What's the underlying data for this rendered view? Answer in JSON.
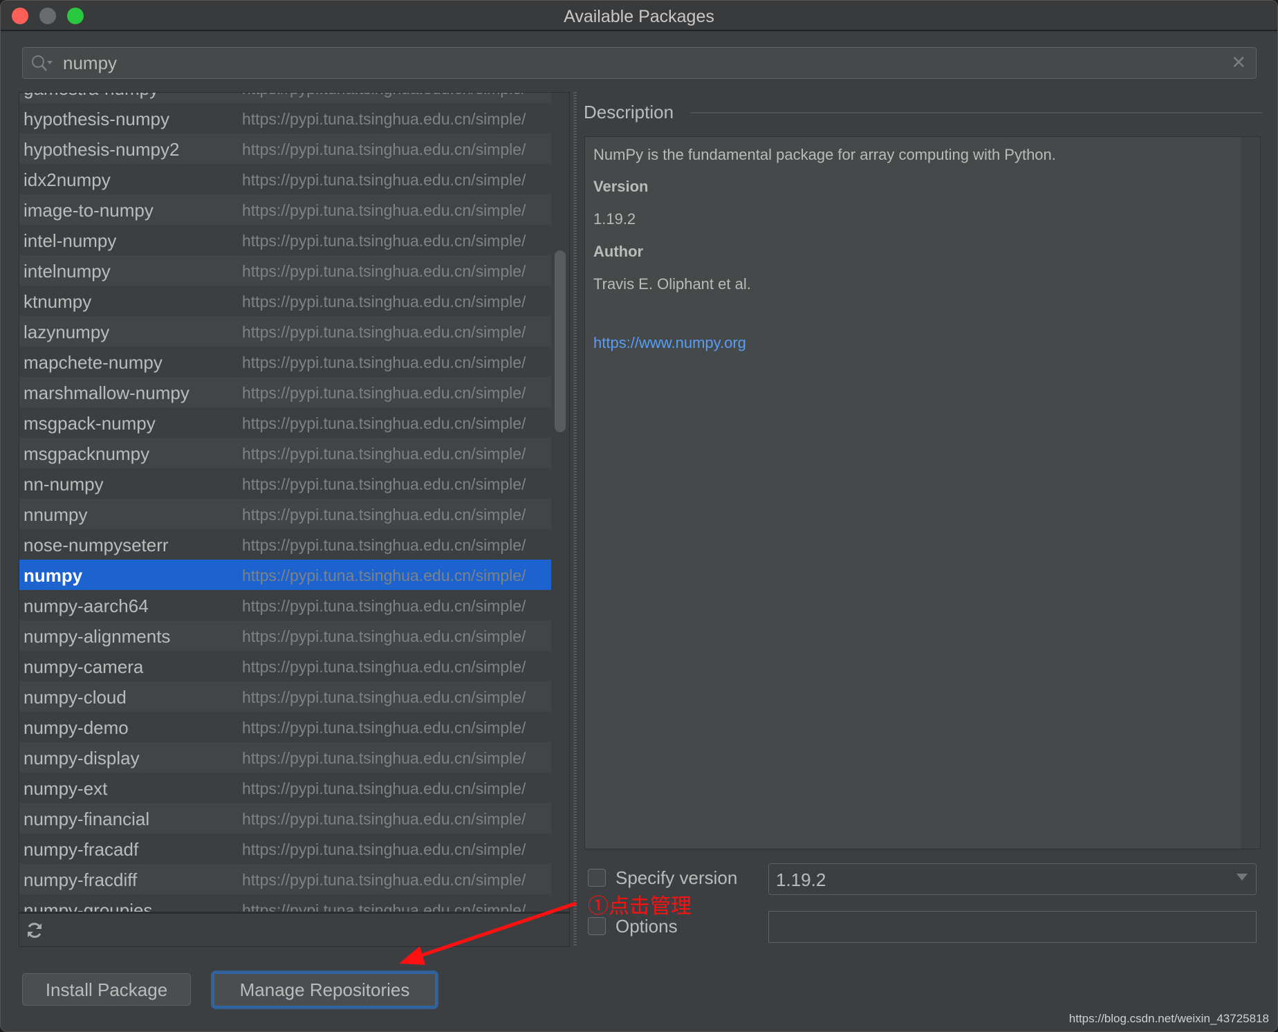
{
  "window": {
    "title": "Available Packages",
    "traffic_lights": [
      "#fe5f57",
      "#6a6b6d",
      "#2ac840"
    ]
  },
  "search": {
    "value": "numpy",
    "icon": "search-icon",
    "clear_icon": "close-icon"
  },
  "packages": [
    {
      "name": "gamestra-numpy",
      "url": "https://pypi.tuna.tsinghua.edu.cn/simple/"
    },
    {
      "name": "hypothesis-numpy",
      "url": "https://pypi.tuna.tsinghua.edu.cn/simple/"
    },
    {
      "name": "hypothesis-numpy2",
      "url": "https://pypi.tuna.tsinghua.edu.cn/simple/"
    },
    {
      "name": "idx2numpy",
      "url": "https://pypi.tuna.tsinghua.edu.cn/simple/"
    },
    {
      "name": "image-to-numpy",
      "url": "https://pypi.tuna.tsinghua.edu.cn/simple/"
    },
    {
      "name": "intel-numpy",
      "url": "https://pypi.tuna.tsinghua.edu.cn/simple/"
    },
    {
      "name": "intelnumpy",
      "url": "https://pypi.tuna.tsinghua.edu.cn/simple/"
    },
    {
      "name": "ktnumpy",
      "url": "https://pypi.tuna.tsinghua.edu.cn/simple/"
    },
    {
      "name": "lazynumpy",
      "url": "https://pypi.tuna.tsinghua.edu.cn/simple/"
    },
    {
      "name": "mapchete-numpy",
      "url": "https://pypi.tuna.tsinghua.edu.cn/simple/"
    },
    {
      "name": "marshmallow-numpy",
      "url": "https://pypi.tuna.tsinghua.edu.cn/simple/"
    },
    {
      "name": "msgpack-numpy",
      "url": "https://pypi.tuna.tsinghua.edu.cn/simple/"
    },
    {
      "name": "msgpacknumpy",
      "url": "https://pypi.tuna.tsinghua.edu.cn/simple/"
    },
    {
      "name": "nn-numpy",
      "url": "https://pypi.tuna.tsinghua.edu.cn/simple/"
    },
    {
      "name": "nnumpy",
      "url": "https://pypi.tuna.tsinghua.edu.cn/simple/"
    },
    {
      "name": "nose-numpyseterr",
      "url": "https://pypi.tuna.tsinghua.edu.cn/simple/"
    },
    {
      "name": "numpy",
      "url": "https://pypi.tuna.tsinghua.edu.cn/simple/",
      "selected": true
    },
    {
      "name": "numpy-aarch64",
      "url": "https://pypi.tuna.tsinghua.edu.cn/simple/"
    },
    {
      "name": "numpy-alignments",
      "url": "https://pypi.tuna.tsinghua.edu.cn/simple/"
    },
    {
      "name": "numpy-camera",
      "url": "https://pypi.tuna.tsinghua.edu.cn/simple/"
    },
    {
      "name": "numpy-cloud",
      "url": "https://pypi.tuna.tsinghua.edu.cn/simple/"
    },
    {
      "name": "numpy-demo",
      "url": "https://pypi.tuna.tsinghua.edu.cn/simple/"
    },
    {
      "name": "numpy-display",
      "url": "https://pypi.tuna.tsinghua.edu.cn/simple/"
    },
    {
      "name": "numpy-ext",
      "url": "https://pypi.tuna.tsinghua.edu.cn/simple/"
    },
    {
      "name": "numpy-financial",
      "url": "https://pypi.tuna.tsinghua.edu.cn/simple/"
    },
    {
      "name": "numpy-fracadf",
      "url": "https://pypi.tuna.tsinghua.edu.cn/simple/"
    },
    {
      "name": "numpy-fracdiff",
      "url": "https://pypi.tuna.tsinghua.edu.cn/simple/"
    },
    {
      "name": "numpy-groupies",
      "url": "https://pypi.tuna.tsinghua.edu.cn/simple/"
    }
  ],
  "list_toolbar": {
    "refresh_icon": "refresh-icon"
  },
  "description": {
    "label": "Description",
    "summary": "NumPy is the fundamental package for array computing with Python.",
    "version_label": "Version",
    "version": "1.19.2",
    "author_label": "Author",
    "author": "Travis E. Oliphant et al.",
    "link": "https://www.numpy.org"
  },
  "specify_version": {
    "label": "Specify version",
    "checked": false,
    "value": "1.19.2"
  },
  "options": {
    "label": "Options",
    "checked": false,
    "value": ""
  },
  "buttons": {
    "install": "Install Package",
    "manage": "Manage Repositories"
  },
  "annotation": {
    "text": "①点击管理",
    "color": "#ff1010"
  },
  "watermark": "https://blog.csdn.net/weixin_43725818"
}
